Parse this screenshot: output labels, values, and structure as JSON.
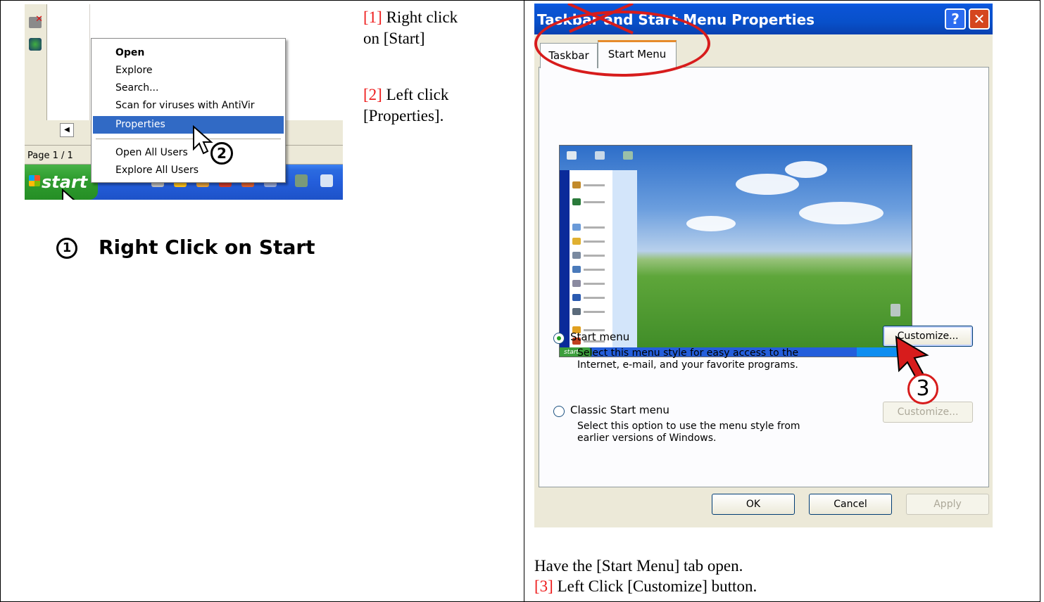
{
  "left_screenshot": {
    "context_menu": {
      "items": [
        {
          "label": "Open",
          "bold": true
        },
        {
          "label": "Explore"
        },
        {
          "label": "Search..."
        },
        {
          "label": "Scan for viruses with AntiVir"
        },
        {
          "label": "Properties",
          "highlighted": true
        },
        {
          "label": "Open All Users"
        },
        {
          "label": "Explore All Users"
        }
      ]
    },
    "status_bar": {
      "page": "Page 1 / 1"
    },
    "taskbar": {
      "start_label": "start"
    },
    "step2_number": "2",
    "caption_number": "1",
    "caption": "Right Click on Start"
  },
  "middle_text": {
    "step1_num": "[1]",
    "step1_text": "Right click",
    "step1_text2": "on [Start]",
    "step2_num": "[2]",
    "step2_text": "Left click",
    "step2_text2": "[Properties]."
  },
  "dialog": {
    "title": "Taskbar and Start Menu Properties",
    "help_button": "?",
    "close_button": "✕",
    "tabs": [
      {
        "label": "Taskbar",
        "selected": false
      },
      {
        "label": "Start Menu",
        "selected": true
      }
    ],
    "preview_start": "start",
    "options": [
      {
        "label": "Start menu",
        "selected": true,
        "description_line1": "Select this menu style for easy access to the",
        "description_line2": "Internet, e-mail, and your favorite programs.",
        "button": "Customize...",
        "button_enabled": true
      },
      {
        "label": "Classic Start menu",
        "selected": false,
        "description_line1": "Select this option to use the menu style from",
        "description_line2": "earlier versions of Windows.",
        "button": "Customize...",
        "button_enabled": false
      }
    ],
    "footer_buttons": {
      "ok": "OK",
      "cancel": "Cancel",
      "apply": "Apply"
    },
    "step3_number": "3"
  },
  "right_text": {
    "line1": "Have the [Start Menu] tab open.",
    "step3_num": "[3]",
    "step3_text": "Left Click [Customize] button."
  },
  "colors": {
    "step_number": "#ee1c1c",
    "annotation_red": "#d71c1c",
    "menu_highlight": "#316ac5",
    "xp_blue": "#0850ca"
  }
}
